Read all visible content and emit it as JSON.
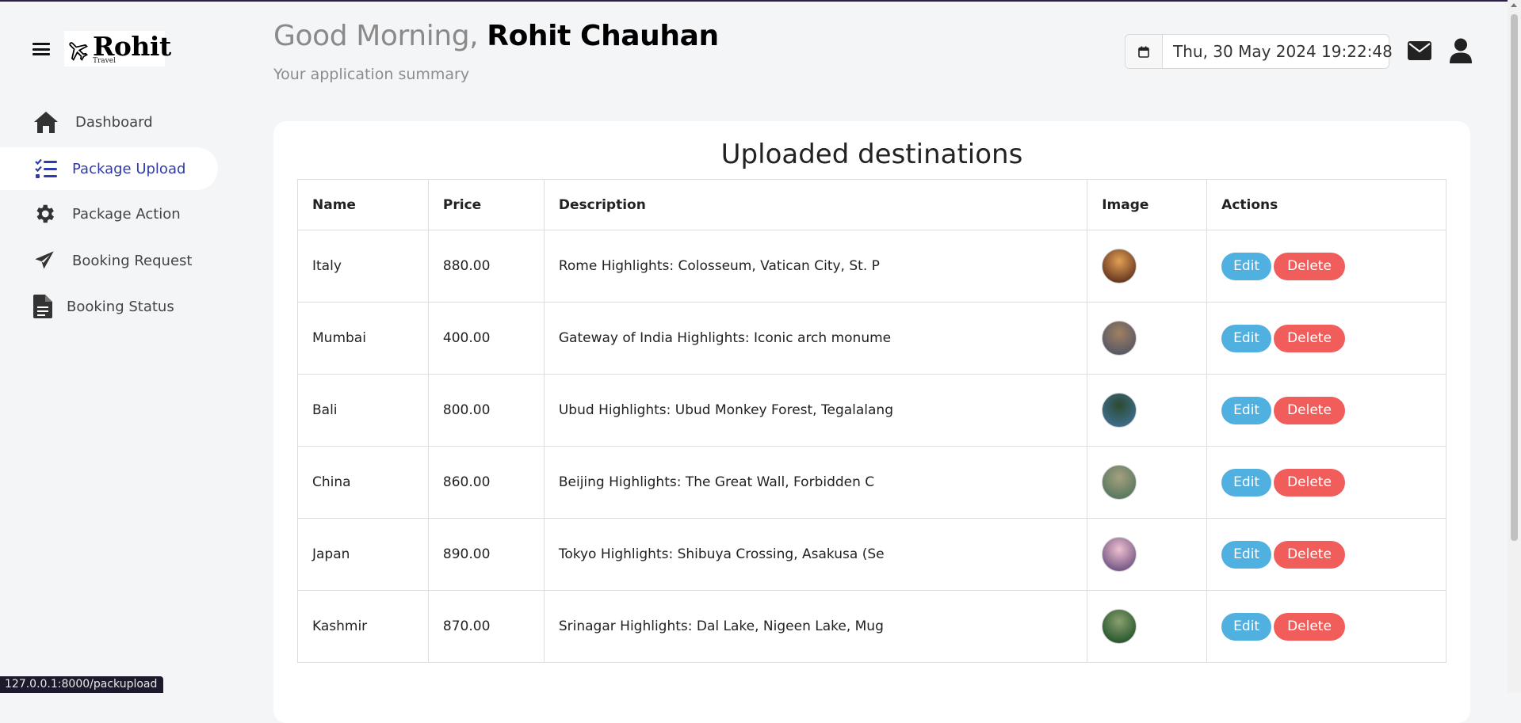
{
  "brand": {
    "name": "Rohit",
    "sub": "Travel"
  },
  "sidebar": {
    "items": [
      {
        "label": "Dashboard",
        "icon": "home-icon"
      },
      {
        "label": "Package Upload",
        "icon": "list-check-icon",
        "active": true
      },
      {
        "label": "Package Action",
        "icon": "gear-icon"
      },
      {
        "label": "Booking Request",
        "icon": "paper-plane-icon"
      },
      {
        "label": "Booking Status",
        "icon": "document-icon"
      }
    ]
  },
  "header": {
    "greeting": "Good Morning,",
    "user_name": "Rohit Chauhan",
    "subtitle": "Your application summary",
    "datetime": "Thu, 30 May 2024 19:22:48"
  },
  "table": {
    "title": "Uploaded destinations",
    "columns": [
      "Name",
      "Price",
      "Description",
      "Image",
      "Actions"
    ],
    "edit_label": "Edit",
    "delete_label": "Delete",
    "rows": [
      {
        "name": "Italy",
        "price": "880.00",
        "description": "Rome Highlights: Colosseum, Vatican City, St. P",
        "image_colors": [
          "#6b3a22",
          "#e3a054"
        ]
      },
      {
        "name": "Mumbai",
        "price": "400.00",
        "description": "Gateway of India Highlights: Iconic arch monume",
        "image_colors": [
          "#5a5a66",
          "#a08060"
        ]
      },
      {
        "name": "Bali",
        "price": "800.00",
        "description": "Ubud Highlights: Ubud Monkey Forest, Tegalalang",
        "image_colors": [
          "#3d6b88",
          "#2c4a30"
        ]
      },
      {
        "name": "China",
        "price": "860.00",
        "description": "Beijing Highlights: The Great Wall, Forbidden C",
        "image_colors": [
          "#5a7a60",
          "#a6a080"
        ]
      },
      {
        "name": "Japan",
        "price": "890.00",
        "description": "Tokyo Highlights: Shibuya Crossing, Asakusa (Se",
        "image_colors": [
          "#7a5c88",
          "#f0c0d0"
        ]
      },
      {
        "name": "Kashmir",
        "price": "870.00",
        "description": "Srinagar Highlights: Dal Lake, Nigeen Lake, Mug",
        "image_colors": [
          "#2c5a30",
          "#8aa070"
        ]
      }
    ]
  },
  "status_url": "127.0.0.1:8000/packupload",
  "colors": {
    "active_nav": "#2e3ba8",
    "edit_button": "#50b0e0",
    "delete_button": "#f15d5a",
    "background": "#f4f5f7"
  }
}
